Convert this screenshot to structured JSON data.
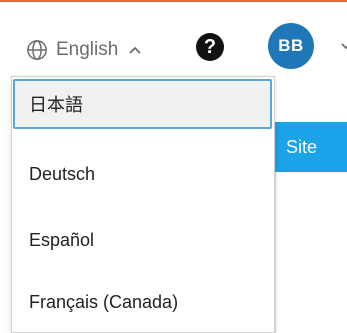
{
  "header": {
    "language_label": "English",
    "help_label": "?",
    "avatar_initials": "BB"
  },
  "side_button": {
    "label": "Site"
  },
  "language_menu": {
    "items": [
      {
        "label": "日本語",
        "highlighted": true
      },
      {
        "label": "Deutsch",
        "highlighted": false
      },
      {
        "label": "Español",
        "highlighted": false
      },
      {
        "label": "Français (Canada)",
        "highlighted": false
      }
    ]
  },
  "colors": {
    "top_accent": "#e06a3a",
    "avatar_bg": "#1f77b8",
    "site_button_bg": "#1aa3e8",
    "focus_border": "#57a9d8"
  },
  "icons": {
    "language": "globe-icon",
    "toggle": "chevron-up-icon",
    "help": "help-icon",
    "avatar_menu": "chevron-down-icon"
  }
}
